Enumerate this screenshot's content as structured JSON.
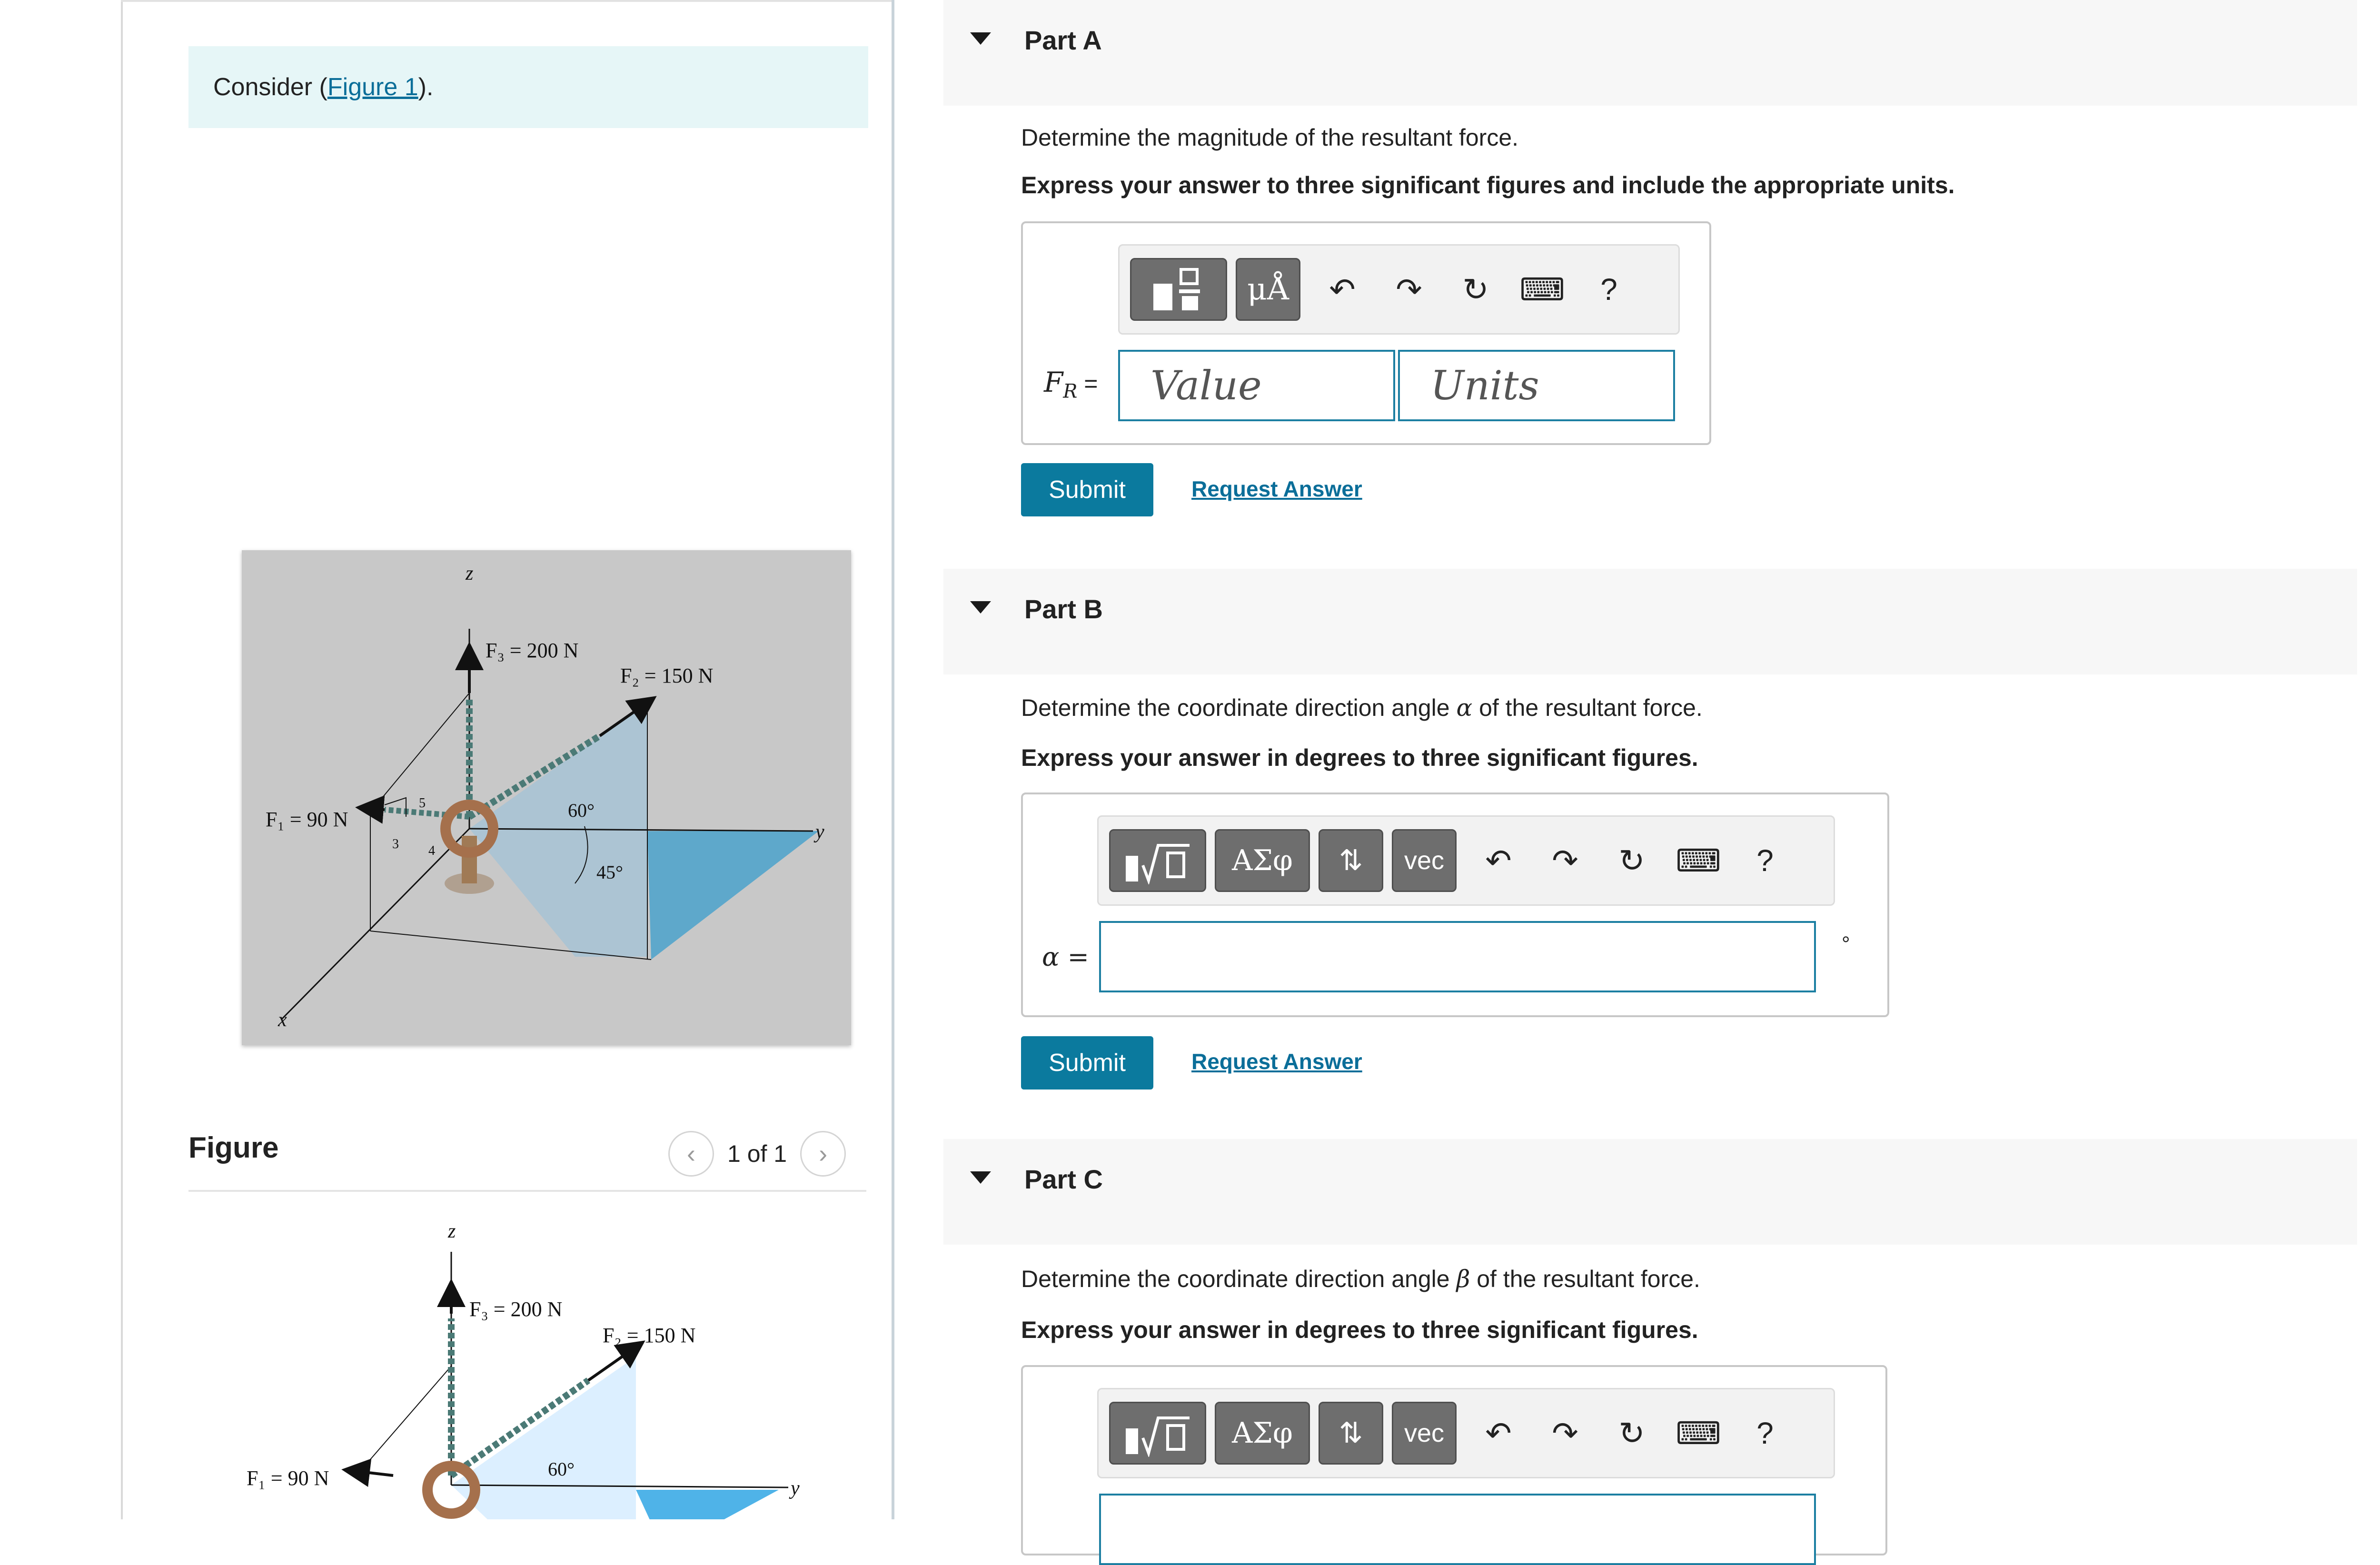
{
  "left": {
    "consider_prefix": "Consider (",
    "consider_link": "Figure 1",
    "consider_suffix": ").",
    "figure_title": "Figure",
    "pager_text": "1 of 1"
  },
  "figure_labels": {
    "z": "z",
    "x": "x",
    "y": "y",
    "F3": "F₃ = 200 N",
    "F2": "F₂ = 150 N",
    "F1": "F₁ = 90 N",
    "angle60": "60°",
    "angle45": "45°",
    "tri5": "5",
    "tri3": "3",
    "tri4": "4"
  },
  "parts": [
    {
      "title": "Part A",
      "question": "Determine the magnitude of the resultant force.",
      "instruction": "Express your answer to three significant figures and include the appropriate units.",
      "var_label": "F",
      "var_sub": "R",
      "eq": " =",
      "value_placeholder": "Value",
      "units_placeholder": "Units",
      "submit": "Submit",
      "request": "Request Answer",
      "buttons": [
        "template",
        "μÅ"
      ]
    },
    {
      "title": "Part B",
      "question_pre": "Determine the coordinate direction angle ",
      "symbol": "α",
      "question_post": " of the resultant force.",
      "instruction": "Express your answer in degrees to three significant figures.",
      "var_label": "α =",
      "unit": "°",
      "submit": "Submit",
      "request": "Request Answer",
      "buttons": [
        "√template",
        "ΑΣφ",
        "⇅",
        "vec"
      ]
    },
    {
      "title": "Part C",
      "question_pre": "Determine the coordinate direction angle ",
      "symbol": "β",
      "question_post": " of the resultant force.",
      "instruction": "Express your answer in degrees to three significant figures.",
      "buttons": [
        "√template",
        "ΑΣφ",
        "⇅",
        "vec"
      ]
    }
  ],
  "toolbar_icons": [
    "undo-icon",
    "redo-icon",
    "reset-icon",
    "keyboard-icon",
    "help-icon"
  ],
  "help_glyph": "?"
}
